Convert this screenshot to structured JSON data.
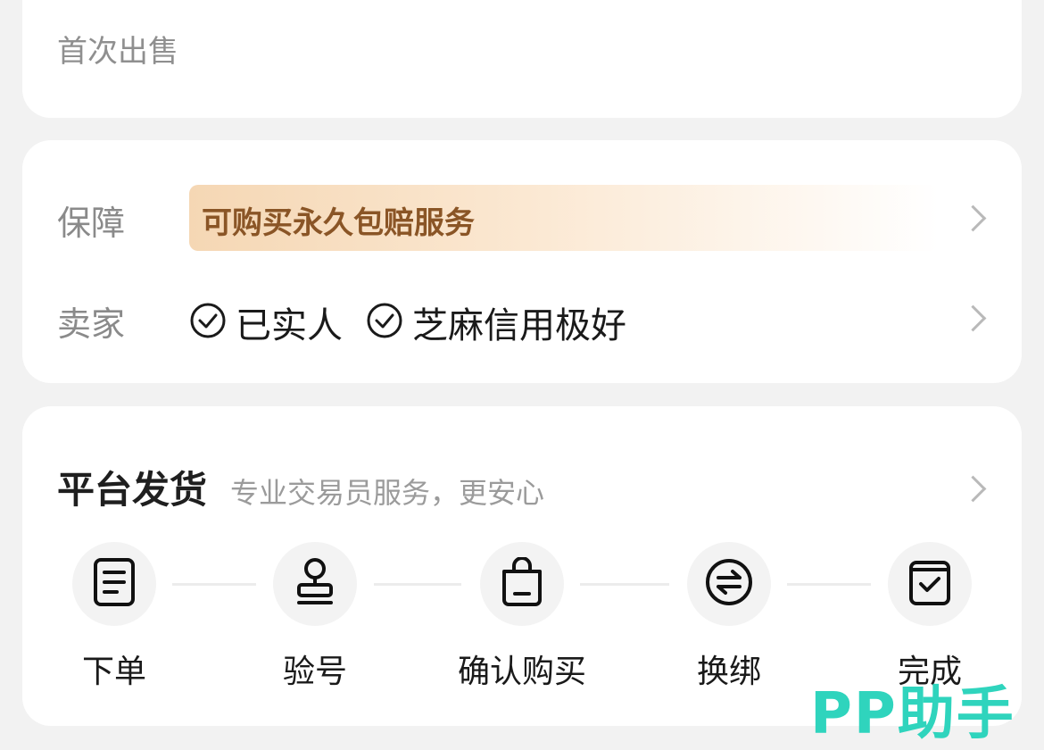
{
  "top_card": {
    "text": "首次出售"
  },
  "guarantee": {
    "label": "保障",
    "text": "可购买永久包赔服务"
  },
  "seller": {
    "label": "卖家",
    "tags": [
      "已实人",
      "芝麻信用极好"
    ]
  },
  "delivery": {
    "title": "平台发货",
    "subtitle": "专业交易员服务，更安心",
    "steps": [
      {
        "label": "下单",
        "icon": "document-icon"
      },
      {
        "label": "验号",
        "icon": "stamp-icon"
      },
      {
        "label": "确认购买",
        "icon": "shopping-bag-icon"
      },
      {
        "label": "换绑",
        "icon": "swap-icon"
      },
      {
        "label": "完成",
        "icon": "check-box-icon"
      }
    ]
  },
  "watermark": "PP助手",
  "colors": {
    "guarantee_text": "#8a5526",
    "watermark": "#2fd4bd",
    "background": "#f2f2f2"
  }
}
